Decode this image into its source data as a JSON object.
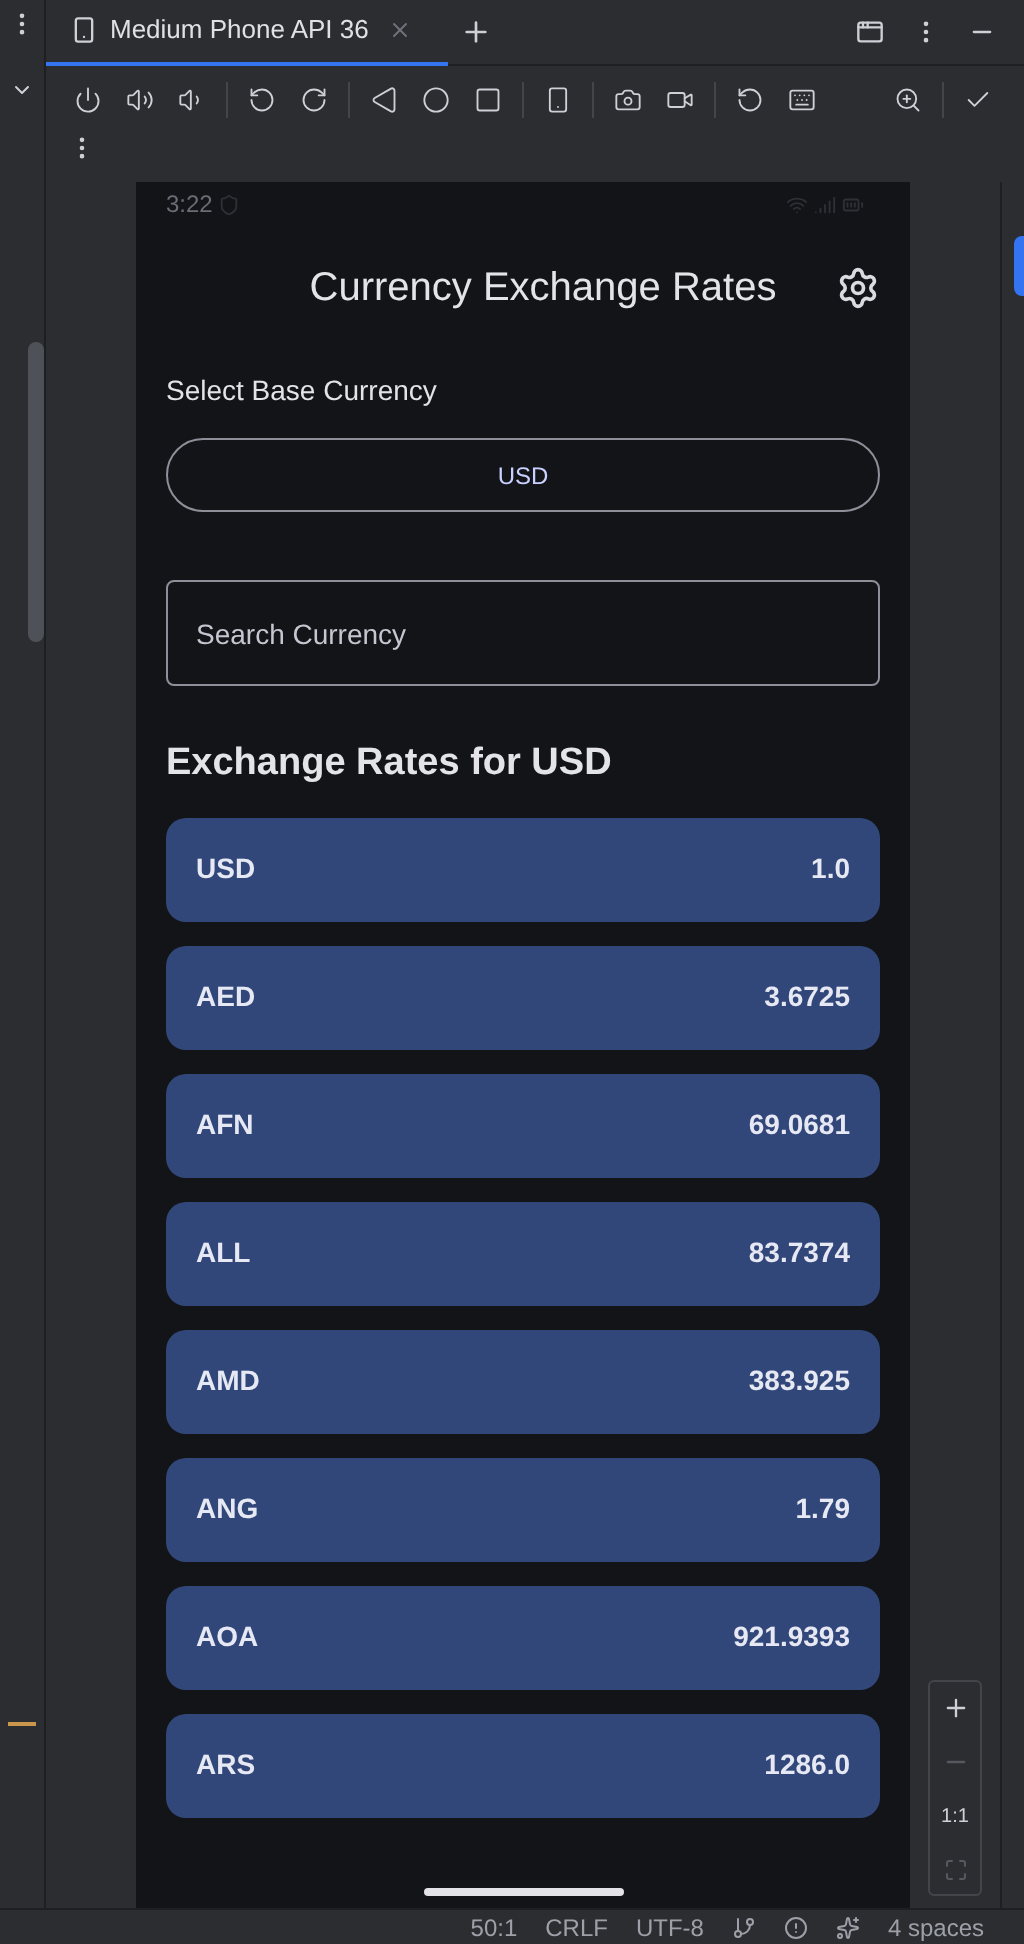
{
  "device_tab": {
    "title": "Medium Phone API 36",
    "selected": true
  },
  "zoom_controls": {
    "actual_size_label": "1:1"
  },
  "phone": {
    "status_bar": {
      "time": "3:22"
    },
    "app": {
      "title": "Currency Exchange Rates",
      "base_label": "Select Base Currency",
      "base_value": "USD",
      "search": {
        "placeholder": "Search Currency"
      },
      "rates_heading": "Exchange Rates for USD",
      "rates": [
        {
          "code": "USD",
          "rate": "1.0"
        },
        {
          "code": "AED",
          "rate": "3.6725"
        },
        {
          "code": "AFN",
          "rate": "69.0681"
        },
        {
          "code": "ALL",
          "rate": "83.7374"
        },
        {
          "code": "AMD",
          "rate": "383.925"
        },
        {
          "code": "ANG",
          "rate": "1.79"
        },
        {
          "code": "AOA",
          "rate": "921.9393"
        },
        {
          "code": "ARS",
          "rate": "1286.0"
        }
      ]
    }
  },
  "status_bar": [
    "50:1",
    "CRLF",
    "UTF-8",
    "4 spaces"
  ]
}
